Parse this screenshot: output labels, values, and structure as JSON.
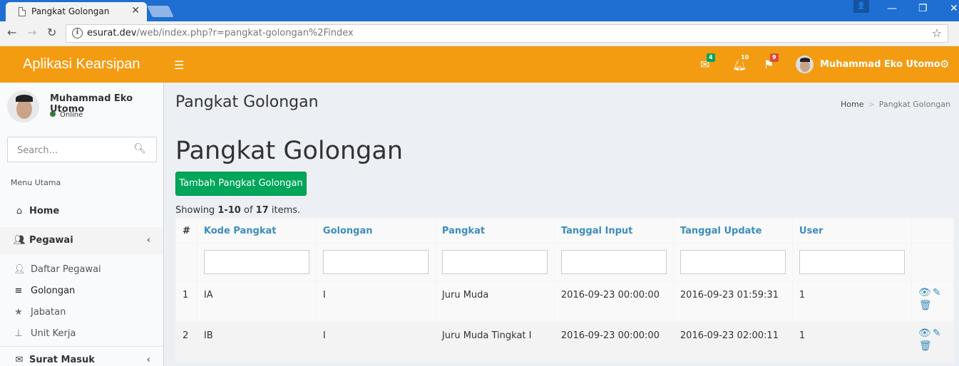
{
  "browser": {
    "tab_title": "Pangkat Golongan",
    "tab_close": "✕",
    "url_domain": "esurat.dev",
    "url_rest": "/web/index.php?r=pangkat-golongan%2Findex"
  },
  "header": {
    "logo": "Aplikasi Kearsipan",
    "mail_count": "4",
    "notif_count": "10",
    "flag_count": "9",
    "username": "Muhammad Eko Utomo",
    "badge_colors": {
      "mail": "#00a65a",
      "notif": "#f39c12",
      "flag": "#dd4b39"
    }
  },
  "sidebar": {
    "username": "Muhammad Eko Utomo",
    "status": "Online",
    "search_placeholder": "Search...",
    "menu_header": "Menu Utama",
    "items": {
      "home": "Home",
      "pegawai": "Pegawai",
      "daftar_pegawai": "Daftar Pegawai",
      "golongan": "Golongan",
      "jabatan": "Jabatan",
      "unit_kerja": "Unit Kerja",
      "surat_masuk": "Surat Masuk"
    }
  },
  "content": {
    "page_header": "Pangkat Golongan",
    "breadcrumb_home": "Home",
    "breadcrumb_current": "Pangkat Golongan",
    "title": "Pangkat Golongan",
    "add_button": "Tambah Pangkat Golongan",
    "summary_prefix": "Showing ",
    "summary_range": "1-10",
    "summary_mid": " of ",
    "summary_total": "17",
    "summary_suffix": " items."
  },
  "table": {
    "columns": [
      "#",
      "Kode Pangkat",
      "Golongan",
      "Pangkat",
      "Tanggal Input",
      "Tanggal Update",
      "User"
    ],
    "rows": [
      {
        "no": "1",
        "kode": "IA",
        "golongan": "I",
        "pangkat": "Juru Muda",
        "input": "2016-09-23 00:00:00",
        "update": "2016-09-23 01:59:31",
        "user": "1"
      },
      {
        "no": "2",
        "kode": "IB",
        "golongan": "I",
        "pangkat": "Juru Muda Tingkat I",
        "input": "2016-09-23 00:00:00",
        "update": "2016-09-23 02:00:11",
        "user": "1"
      }
    ]
  },
  "colors": {
    "header_bg": "#f39c12",
    "add_button_bg": "#00a65a",
    "link": "#3c8dbc"
  }
}
